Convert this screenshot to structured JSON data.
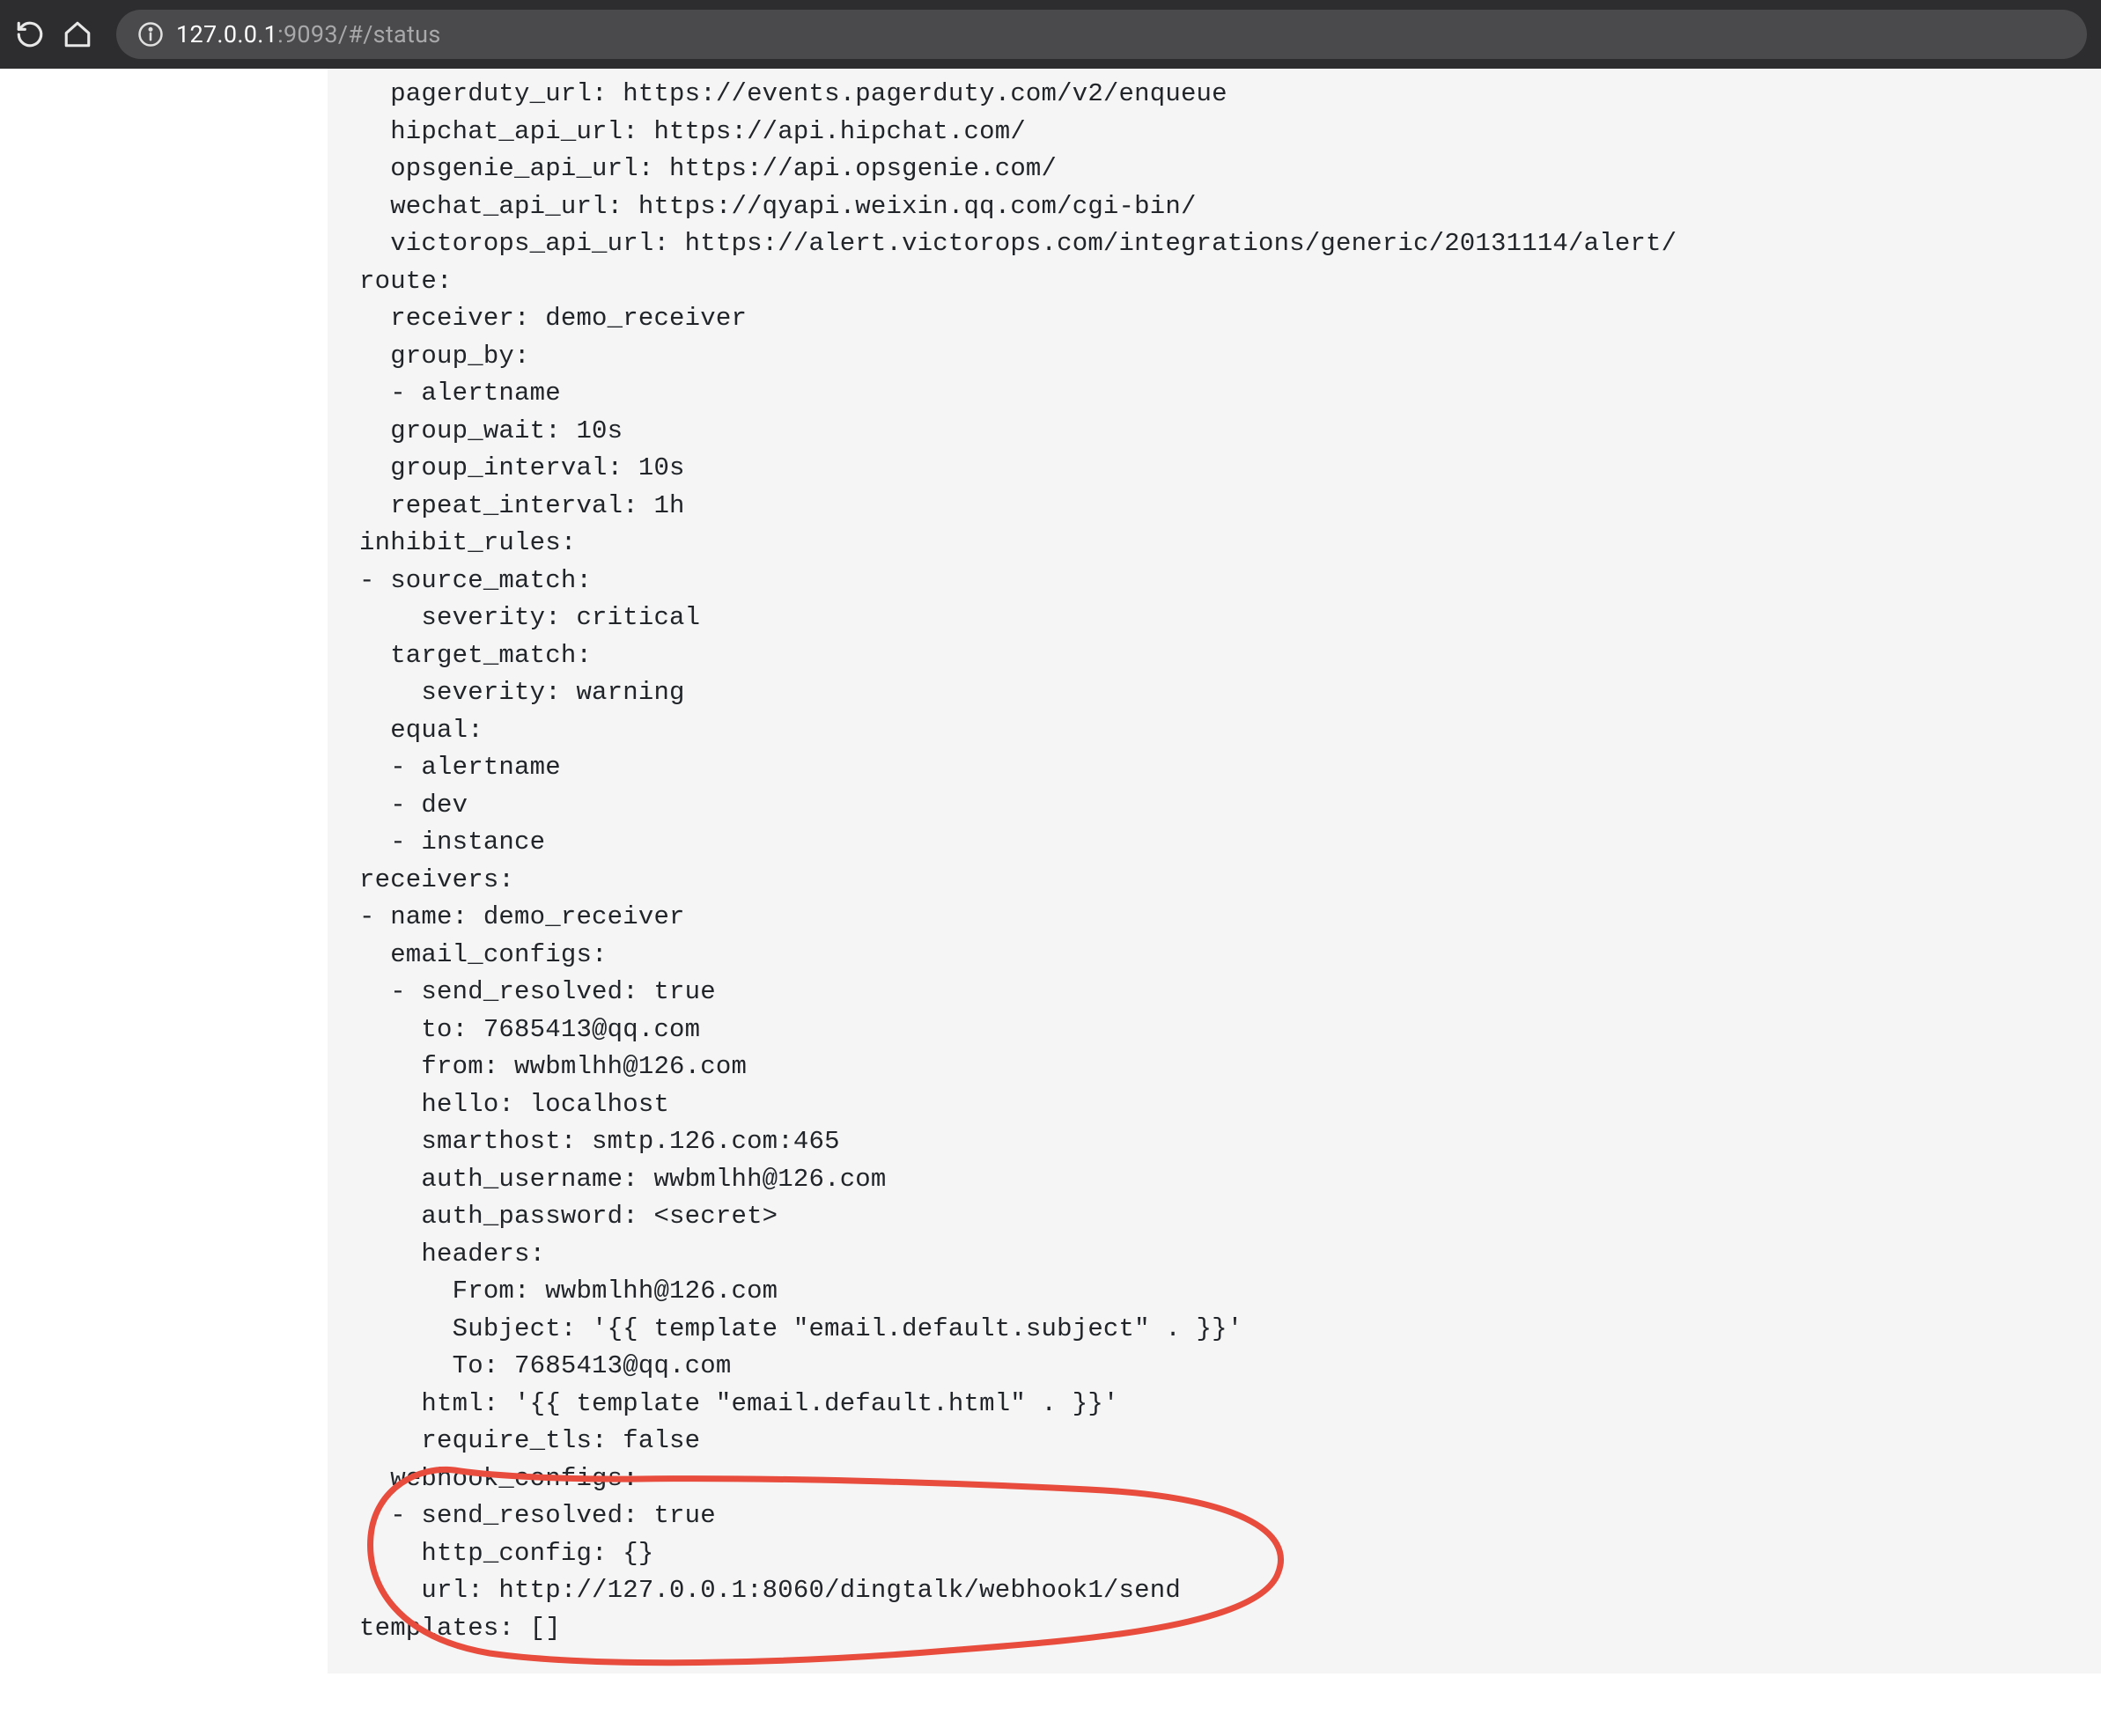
{
  "browser": {
    "url_host": "127.0.0.1",
    "url_port": ":9093",
    "url_path": "/#/status"
  },
  "config": {
    "lines": [
      "  pagerduty_url: https://events.pagerduty.com/v2/enqueue",
      "  hipchat_api_url: https://api.hipchat.com/",
      "  opsgenie_api_url: https://api.opsgenie.com/",
      "  wechat_api_url: https://qyapi.weixin.qq.com/cgi-bin/",
      "  victorops_api_url: https://alert.victorops.com/integrations/generic/20131114/alert/",
      "route:",
      "  receiver: demo_receiver",
      "  group_by:",
      "  - alertname",
      "  group_wait: 10s",
      "  group_interval: 10s",
      "  repeat_interval: 1h",
      "inhibit_rules:",
      "- source_match:",
      "    severity: critical",
      "  target_match:",
      "    severity: warning",
      "  equal:",
      "  - alertname",
      "  - dev",
      "  - instance",
      "receivers:",
      "- name: demo_receiver",
      "  email_configs:",
      "  - send_resolved: true",
      "    to: 7685413@qq.com",
      "    from: wwbmlhh@126.com",
      "    hello: localhost",
      "    smarthost: smtp.126.com:465",
      "    auth_username: wwbmlhh@126.com",
      "    auth_password: <secret>",
      "    headers:",
      "      From: wwbmlhh@126.com",
      "      Subject: '{{ template \"email.default.subject\" . }}'",
      "      To: 7685413@qq.com",
      "    html: '{{ template \"email.default.html\" . }}'",
      "    require_tls: false",
      "  webhook_configs:",
      "  - send_resolved: true",
      "    http_config: {}",
      "    url: http://127.0.0.1:8060/dingtalk/webhook1/send",
      "templates: []"
    ]
  }
}
